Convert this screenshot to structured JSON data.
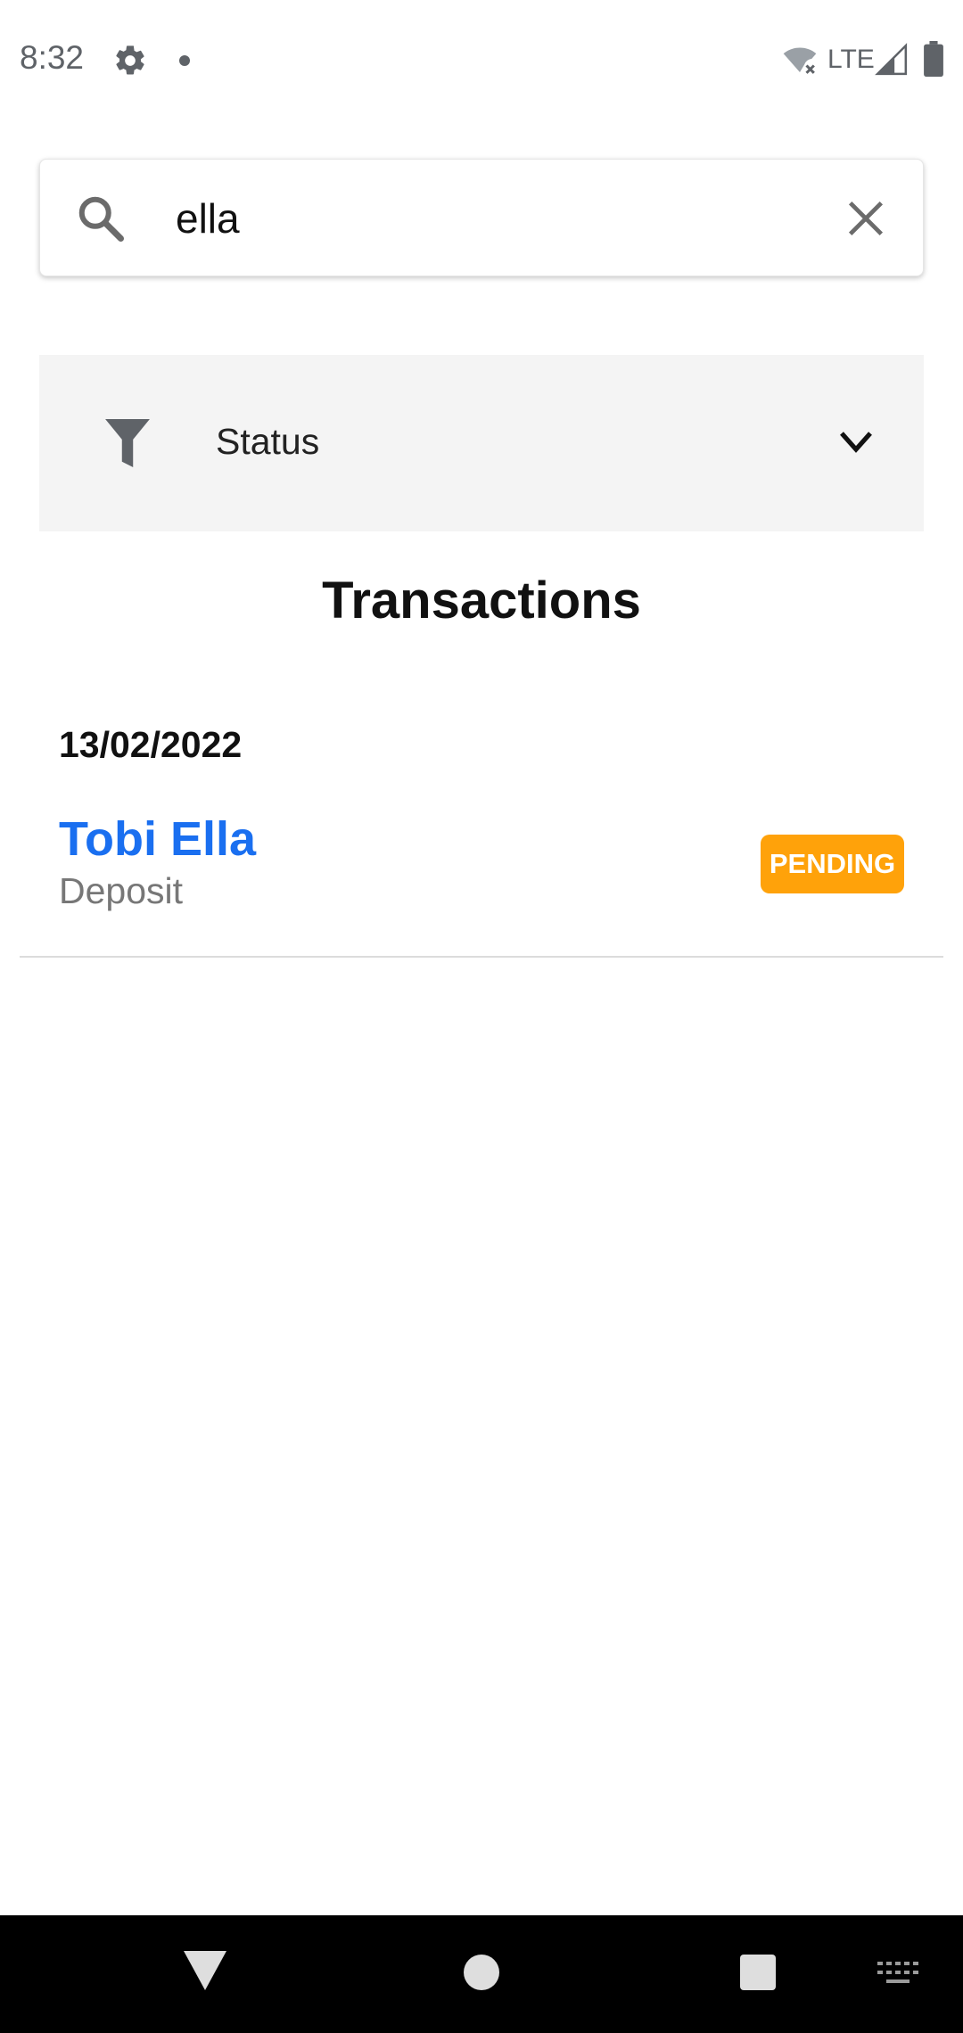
{
  "status_bar": {
    "time": "8:32",
    "network": "LTE",
    "icons": [
      "settings-icon",
      "notification-dot",
      "wifi-off-icon",
      "signal-icon",
      "battery-icon"
    ]
  },
  "search": {
    "value": "ella",
    "icon": "search-icon",
    "clear_icon": "close-icon"
  },
  "filter": {
    "label": "Status",
    "icon": "filter-icon",
    "expand_icon": "chevron-down-icon"
  },
  "page": {
    "title": "Transactions"
  },
  "transactions": [
    {
      "date": "13/02/2022",
      "items": [
        {
          "name": "Tobi Ella",
          "type": "Deposit",
          "status": "PENDING",
          "status_color": "#ffa20a"
        }
      ]
    }
  ],
  "colors": {
    "accent": "#1a6ff0",
    "pending": "#ffa20a",
    "filter_bg": "#f4f4f4"
  },
  "nav_bar": {
    "buttons": [
      "back-icon",
      "home-icon",
      "recents-icon",
      "keyboard-icon"
    ]
  }
}
